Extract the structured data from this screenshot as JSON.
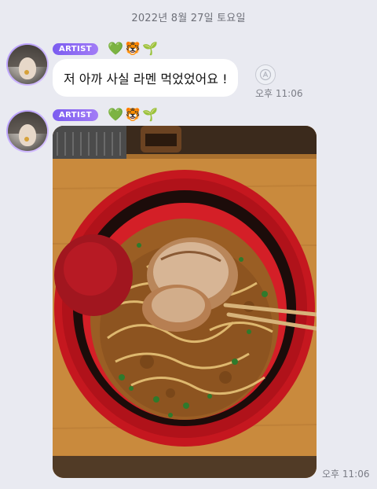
{
  "chat": {
    "date_header": "2022년 8월 27일 토요일",
    "messages": [
      {
        "badge": "ARTIST",
        "emojis": [
          "💚",
          "🐯",
          "🌱"
        ],
        "text": "저 아까 사실 라멘 먹었었어요 !",
        "time": "오후 11:06"
      },
      {
        "badge": "ARTIST",
        "emojis": [
          "💚",
          "🐯",
          "🌱"
        ],
        "time": "오후 11:06"
      }
    ]
  },
  "colors": {
    "background": "#e9eaf1",
    "badge": "#7b5cf0",
    "avatar_ring": "#b59bff"
  },
  "icons": {
    "translate": "translate-icon"
  }
}
